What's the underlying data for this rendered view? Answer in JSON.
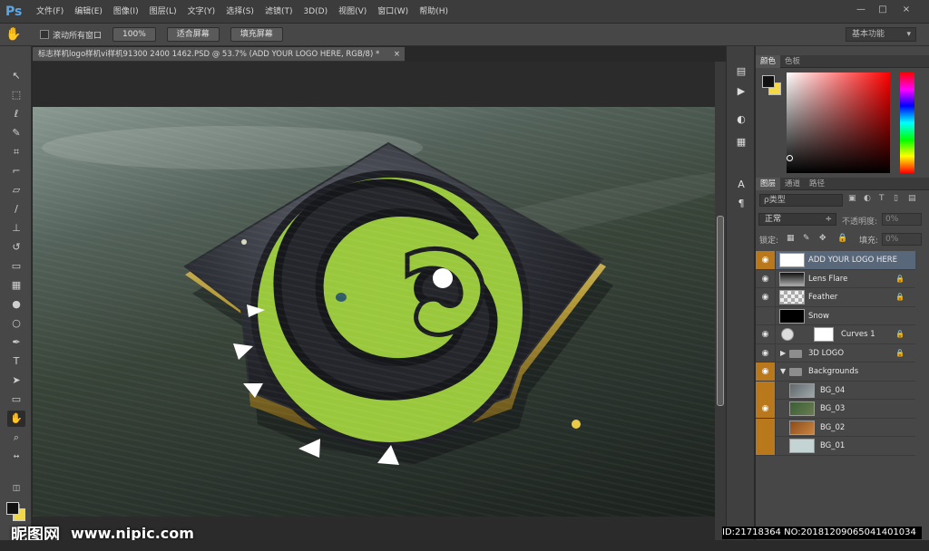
{
  "app": {
    "logo": "Ps",
    "window_controls": [
      "—",
      "□",
      "×"
    ]
  },
  "menu": [
    "文件(F)",
    "编辑(E)",
    "图像(I)",
    "图层(L)",
    "文字(Y)",
    "选择(S)",
    "滤镜(T)",
    "3D(D)",
    "视图(V)",
    "窗口(W)",
    "帮助(H)"
  ],
  "options": {
    "hand_icon": "hand-icon",
    "scroll_all": "滚动所有窗口",
    "buttons": [
      "100%",
      "适合屏幕",
      "填充屏幕"
    ],
    "workspace": "基本功能"
  },
  "document": {
    "tab": "标志样机logo样机vi样机91300 2400 1462.PSD @ 53.7% (ADD YOUR LOGO HERE, RGB/8) *",
    "close": "×"
  },
  "tools": [
    "move-icon",
    "marquee-icon",
    "lasso-icon",
    "quick-select-icon",
    "crop-icon",
    "eyedropper-icon",
    "healing-brush-icon",
    "brush-icon",
    "stamp-icon",
    "history-brush-icon",
    "eraser-icon",
    "gradient-icon",
    "blur-icon",
    "dodge-icon",
    "pen-icon",
    "type-icon",
    "path-select-icon",
    "shape-icon",
    "hand-icon",
    "zoom-icon",
    "swap-colors-icon"
  ],
  "panels": {
    "color_tabs": [
      "颜色",
      "色板"
    ],
    "layer_tabs": [
      "图层",
      "通道",
      "路径"
    ],
    "kind": "ρ类型",
    "blend": "正常",
    "opacity_label": "不透明度:",
    "opacity_value": "0%",
    "lock_label": "锁定:",
    "fill_label": "填充:",
    "fill_value": "0%"
  },
  "layers": [
    {
      "name": "ADD YOUR LOGO HERE",
      "visible": true,
      "selected": true
    },
    {
      "name": "Lens Flare",
      "visible": true,
      "locked": true
    },
    {
      "name": "Feather",
      "visible": true,
      "locked": true
    },
    {
      "name": "Snow",
      "visible": false
    },
    {
      "name": "Curves 1",
      "visible": true,
      "locked": true
    },
    {
      "name": "3D LOGO",
      "visible": true,
      "locked": true
    },
    {
      "name": "Backgrounds",
      "visible": true
    },
    {
      "name": "BG_04",
      "visible": false
    },
    {
      "name": "BG_03",
      "visible": true
    },
    {
      "name": "BG_02",
      "visible": false
    },
    {
      "name": "BG_01",
      "visible": false
    }
  ],
  "watermark": {
    "site": "昵图网",
    "url": "www.nipic.com",
    "id": "ID:21718364 NO:20181209065041401034"
  },
  "colors": {
    "accent": "#b8781b",
    "logo_green": "#9ac83d",
    "bg_swatch": "#f4d84a"
  }
}
